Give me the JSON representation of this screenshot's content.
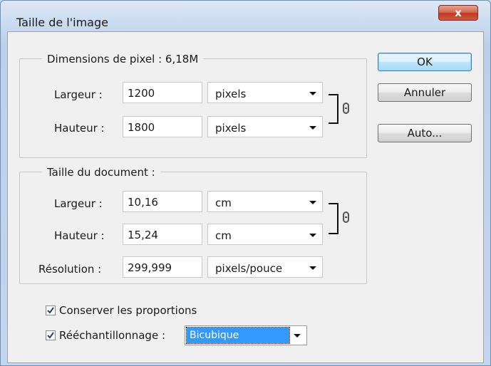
{
  "window": {
    "title": "Taille de l'image",
    "close_label": "x"
  },
  "pixel_dimensions": {
    "heading": "Dimensions de pixel :  6,18M",
    "width": {
      "label": "Largeur :",
      "value": "1200",
      "unit": "pixels"
    },
    "height": {
      "label": "Hauteur :",
      "value": "1800",
      "unit": "pixels"
    },
    "link_icon": "chain-link-icon"
  },
  "document_size": {
    "heading": "Taille du document :",
    "width": {
      "label": "Largeur :",
      "value": "10,16",
      "unit": "cm"
    },
    "height": {
      "label": "Hauteur :",
      "value": "15,24",
      "unit": "cm"
    },
    "resolution": {
      "label": "Résolution :",
      "value": "299,999",
      "unit": "pixels/pouce"
    },
    "link_icon": "chain-link-icon"
  },
  "buttons": {
    "ok": "OK",
    "cancel": "Annuler",
    "auto": "Auto..."
  },
  "options": {
    "constrain": {
      "label": "Conserver les proportions",
      "checked": true
    },
    "resample": {
      "label": "Rééchantillonnage :",
      "checked": true,
      "method": "Bicubique"
    }
  },
  "colors": {
    "selection": "#3399ff",
    "close_button": "#c0391f",
    "default_button_border": "#3c7fb1"
  }
}
